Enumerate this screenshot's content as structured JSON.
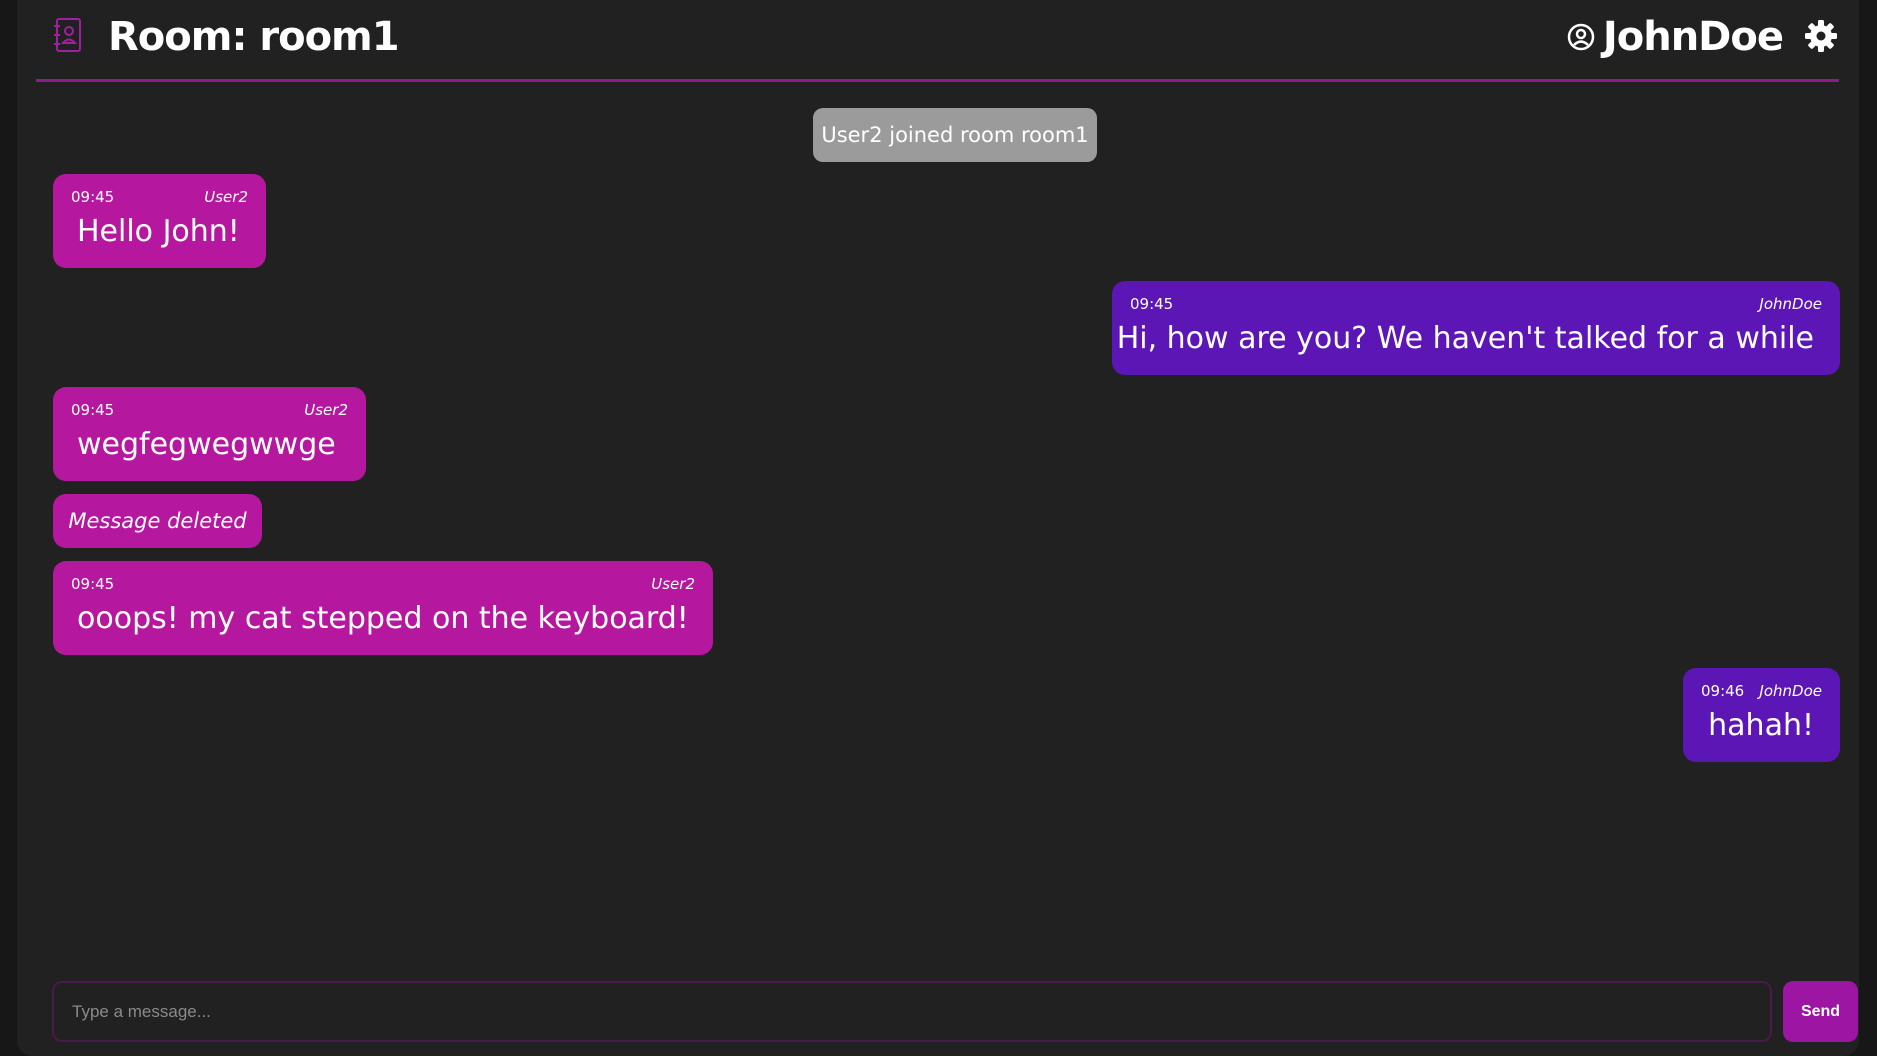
{
  "header": {
    "room_title": "Room: room1",
    "username": "JohnDoe",
    "icons": {
      "room": "room-contact-icon",
      "user": "user-circle-icon",
      "settings": "gear-icon"
    }
  },
  "system_message": "User2 joined room room1",
  "messages": [
    {
      "time": "09:45",
      "author": "User2",
      "text": "Hello John!",
      "from_me": false
    },
    {
      "time": "09:45",
      "author": "JohnDoe",
      "text": "Hi, how are you? We haven't talked for a while",
      "from_me": true
    },
    {
      "time": "09:45",
      "author": "User2",
      "text": "wegfegwegwwge",
      "from_me": false
    },
    {
      "time": "09:45",
      "author": "User2",
      "text": "ooops! my cat stepped on the keyboard!",
      "from_me": false
    },
    {
      "time": "09:46",
      "author": "JohnDoe",
      "text": "hahah!",
      "from_me": true
    }
  ],
  "deleted_message": "Message deleted",
  "composer": {
    "placeholder": "Type a message...",
    "value": "",
    "send_label": "Send"
  },
  "colors": {
    "background": "#212121",
    "accent": "#8e1b8e",
    "other_bubble": "#b6179f",
    "mine_bubble": "#5b16b5",
    "system_bubble": "#9b9b9b",
    "send_button": "#9d15a3"
  }
}
